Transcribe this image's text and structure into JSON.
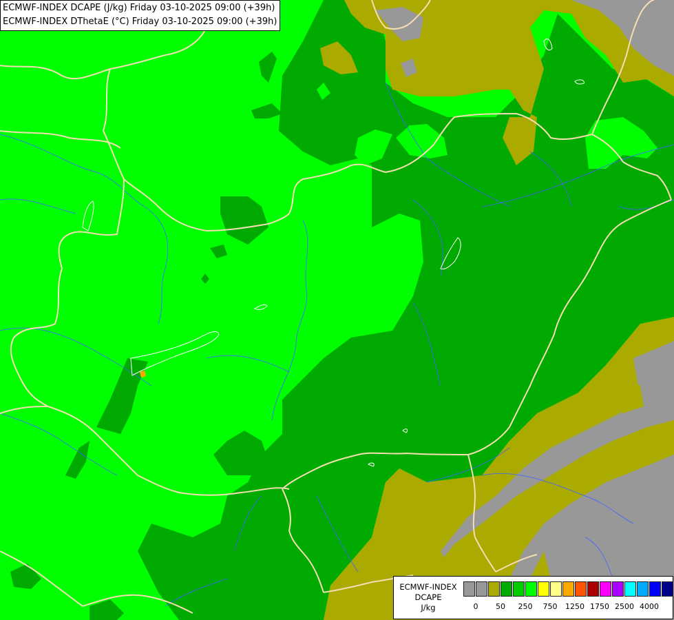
{
  "header": {
    "line1": "ECMWF-INDEX DCAPE (J/kg) Friday 03-10-2025 09:00 (+39h)",
    "line2": "ECMWF-INDEX DThetaE (°C) Friday 03-10-2025 09:00 (+39h)"
  },
  "legend": {
    "title_line1": "ECMWF-INDEX",
    "title_line2": "DCAPE",
    "title_line3": "J/kg",
    "colors": [
      "#989898",
      "#989898",
      "#aaaa00",
      "#00aa00",
      "#00cc00",
      "#00ff00",
      "#ffff00",
      "#ffff88",
      "#ffaa00",
      "#ff5500",
      "#aa0000",
      "#ff00ff",
      "#aa00ff",
      "#00ffff",
      "#00aaff",
      "#0000ff",
      "#000088"
    ],
    "ticks": [
      "0",
      "50",
      "250",
      "750",
      "1250",
      "1750",
      "2500",
      "4000"
    ]
  },
  "palette": {
    "light_green": "#00ff00",
    "dark_green": "#00aa00",
    "olive": "#aaaa00",
    "gray": "#989898",
    "border": "#f5deb3",
    "river": "#4466ff"
  }
}
